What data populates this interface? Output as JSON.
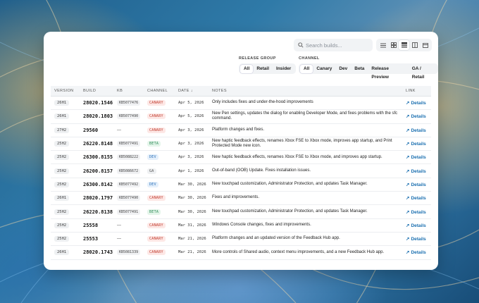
{
  "search": {
    "placeholder": "Search builds..."
  },
  "view_icons": [
    "list-view-icon",
    "grid-view-icon",
    "table-view-icon",
    "board-view-icon",
    "calendar-view-icon"
  ],
  "filters": {
    "release_group": {
      "label": "RELEASE GROUP",
      "options": [
        "All",
        "Retail",
        "Insider"
      ],
      "selected": "All"
    },
    "channel": {
      "label": "CHANNEL",
      "options": [
        "All",
        "Canary",
        "Dev",
        "Beta",
        "Release Preview",
        "GA / Retail"
      ],
      "selected": "All"
    }
  },
  "table": {
    "headers": {
      "version": "VERSION",
      "build": "BUILD",
      "kb": "KB",
      "channel": "CHANNEL",
      "date": "DATE ↓",
      "notes": "NOTES",
      "link": "LINK"
    },
    "link_label": "Details",
    "rows": [
      {
        "version": "26H1",
        "build": "28020.1546",
        "kb": "KB5077476",
        "channel": "CANARY",
        "date": "Apr 5, 2026",
        "notes": "Only includes fixes and under-the-hood improvements"
      },
      {
        "version": "26H1",
        "build": "28020.1803",
        "kb": "KB5077490",
        "channel": "CANARY",
        "date": "Apr 5, 2026",
        "notes": "New Pen settings, updates the dialog for enabling Developer Mode, and fixes problems with the sfc command."
      },
      {
        "version": "27H2",
        "build": "29560",
        "kb": "—",
        "channel": "CANARY",
        "date": "Apr 3, 2026",
        "notes": "Platform changes and fixes."
      },
      {
        "version": "25H2",
        "build": "26220.8148",
        "kb": "KB5077491",
        "channel": "BETA",
        "date": "Apr 3, 2026",
        "notes": "New haptic feedback effects, renames Xbox FSE to Xbox mode, improves app startup, and Print Protected Mode new icon."
      },
      {
        "version": "25H2",
        "build": "26300.8155",
        "kb": "KB5088222",
        "channel": "DEV",
        "date": "Apr 3, 2026",
        "notes": "New haptic feedback effects, renames Xbox FSE to Xbox mode, and improves app startup."
      },
      {
        "version": "25H2",
        "build": "26200.8157",
        "kb": "KB5086672",
        "channel": "GA",
        "date": "Apr 1, 2026",
        "notes": "Out-of-band (OOB) Update. Fixes installation issues."
      },
      {
        "version": "25H2",
        "build": "26300.8142",
        "kb": "KB5077492",
        "channel": "DEV",
        "date": "Mar 30, 2026",
        "notes": "New touchpad customization, Administrator Protection, and updates Task Manager."
      },
      {
        "version": "26H1",
        "build": "28020.1797",
        "kb": "KB5077490",
        "channel": "CANARY",
        "date": "Mar 30, 2026",
        "notes": "Fixes and improvements."
      },
      {
        "version": "25H2",
        "build": "26220.8138",
        "kb": "KB5077491",
        "channel": "BETA",
        "date": "Mar 30, 2026",
        "notes": "New touchpad customization, Administrator Protection, and updates Task Manager."
      },
      {
        "version": "25H2",
        "build": "25558",
        "kb": "—",
        "channel": "CANARY",
        "date": "Mar 31, 2026",
        "notes": "Windows Console changes, fixes and improvements."
      },
      {
        "version": "25H2",
        "build": "25553",
        "kb": "—",
        "channel": "CANARY",
        "date": "Mar 21, 2026",
        "notes": "Platform changes and an updated version of the Feedback Hub app."
      },
      {
        "version": "26H1",
        "build": "28020.1743",
        "kb": "KB5081339",
        "channel": "CANARY",
        "date": "Mar 21, 2026",
        "notes": "More controls of Shared audio, context menu improvements, and a new Feedback Hub app."
      }
    ]
  },
  "colors": {
    "CANARY": {
      "bg": "#fde8e6",
      "fg": "#c0392b"
    },
    "BETA": {
      "bg": "#e4f5ea",
      "fg": "#2e8b57"
    },
    "DEV": {
      "bg": "#e5f0fb",
      "fg": "#2a6fb8"
    },
    "GA": {
      "bg": "#eef0f2",
      "fg": "#555555"
    },
    "link": "#1a6fb0"
  }
}
